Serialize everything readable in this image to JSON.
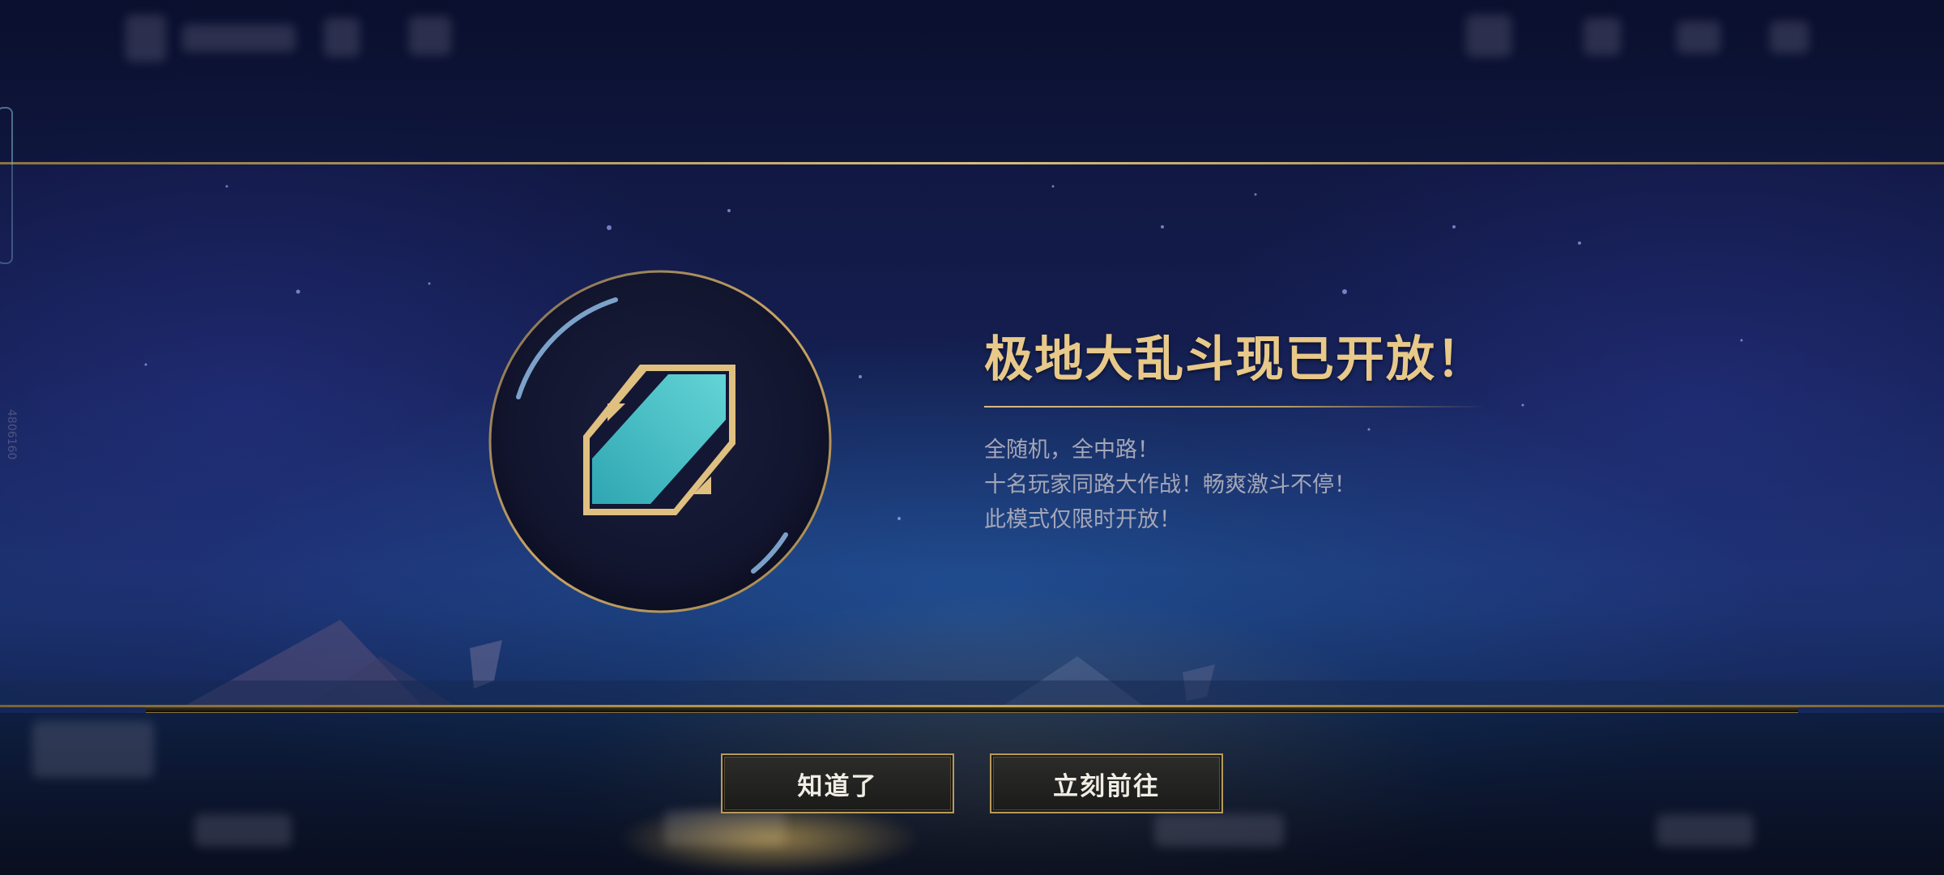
{
  "modal": {
    "title": "极地大乱斗现已开放！",
    "description_lines": [
      "全随机，全中路！",
      "十名玩家同路大作战！畅爽激斗不停！",
      "此模式仅限时开放！"
    ],
    "buttons": {
      "dismiss_label": "知道了",
      "go_label": "立刻前往"
    },
    "emblem": "aram-mode-icon"
  },
  "side_code": "4806160",
  "colors": {
    "title_gold": "#e8c98a",
    "border_gold": "#b89a5a",
    "emblem_teal": "#4fc3c9",
    "description_gray": "#a4a6b6"
  }
}
